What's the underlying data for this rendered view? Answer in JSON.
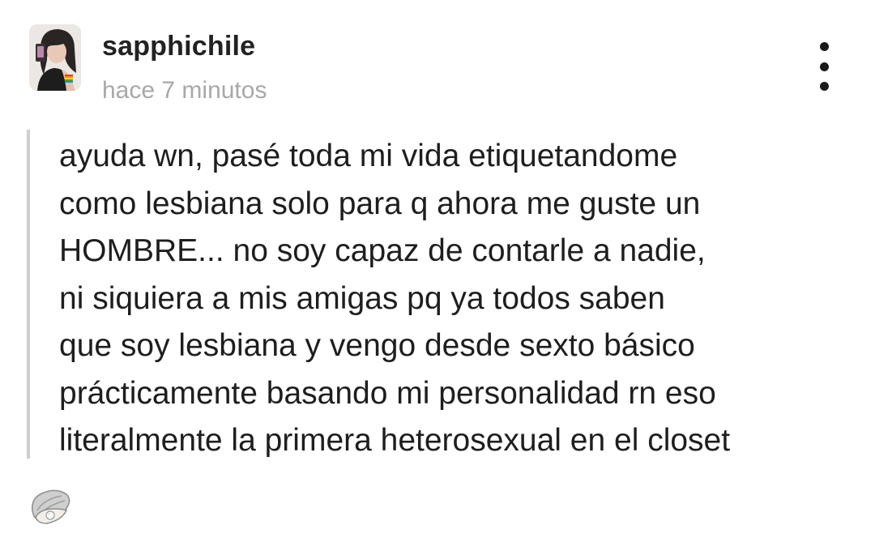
{
  "post": {
    "username": "sapphichile",
    "timestamp": "hace 7 minutos",
    "body_lines": [
      "ayuda wn, pasé toda mi vida etiquetandome",
      "como lesbiana solo para q ahora me guste un",
      "HOMBRE... no soy capaz de contarle a nadie,",
      "ni siquiera a mis amigas pq ya todos saben",
      "que soy lesbiana y vengo desde sexto básico",
      "prácticamente basando mi personalidad rn eso",
      "literalmente la primera heterosexual en el closet"
    ]
  },
  "icons": {
    "avatar": "profile-photo",
    "more": "vertical-ellipsis-icon",
    "reaction": "oyster-icon"
  },
  "colors": {
    "username": "#222222",
    "timestamp": "#a8a8a8",
    "quote_bar": "#cfcfcf",
    "body_text": "#1e1e1e"
  }
}
